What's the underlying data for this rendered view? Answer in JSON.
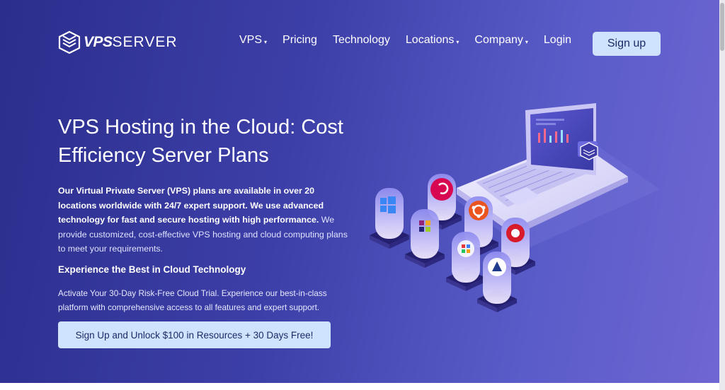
{
  "brand": {
    "logo_bold": "VPS",
    "logo_rest": "SERVER"
  },
  "nav": {
    "items": [
      {
        "label": "VPS",
        "dropdown": true
      },
      {
        "label": "Pricing",
        "dropdown": false
      },
      {
        "label": "Technology",
        "dropdown": false
      },
      {
        "label": "Locations",
        "dropdown": true
      },
      {
        "label": "Company",
        "dropdown": true
      },
      {
        "label": "Login",
        "dropdown": false
      }
    ],
    "signup_label": "Sign up",
    "caret_glyph": "▾"
  },
  "hero": {
    "headline_line1": "VPS Hosting in the Cloud: Cost",
    "headline_line2": "Efficiency Server Plans",
    "intro_strong": "Our Virtual Private Server (VPS) plans are available in over 20 locations worldwide with 24/7 expert support. We use advanced technology for fast and secure hosting with high performance.",
    "intro_light": " We provide customized, cost-effective VPS hosting and cloud computing plans to meet your requirements.",
    "subheading": "Experience the Best in Cloud Technology",
    "trial_text": "Activate Your 30-Day Risk-Free Cloud Trial. Experience our best-in-class platform with comprehensive access to all features and expert support.",
    "cta_label": "Sign Up and Unlock $100 in Resources + 30 Days Free!"
  },
  "colors": {
    "gradient_start": "#2b2e8c",
    "gradient_end": "#6f66d2",
    "button_bg": "#cfe3ff",
    "button_text": "#1d2a66"
  },
  "illustration": {
    "os_icons": [
      "windows-icon",
      "debian-icon",
      "centos-icon",
      "ubuntu-icon",
      "fedora-icon",
      "freebsd-icon",
      "alma-linux-icon"
    ]
  }
}
